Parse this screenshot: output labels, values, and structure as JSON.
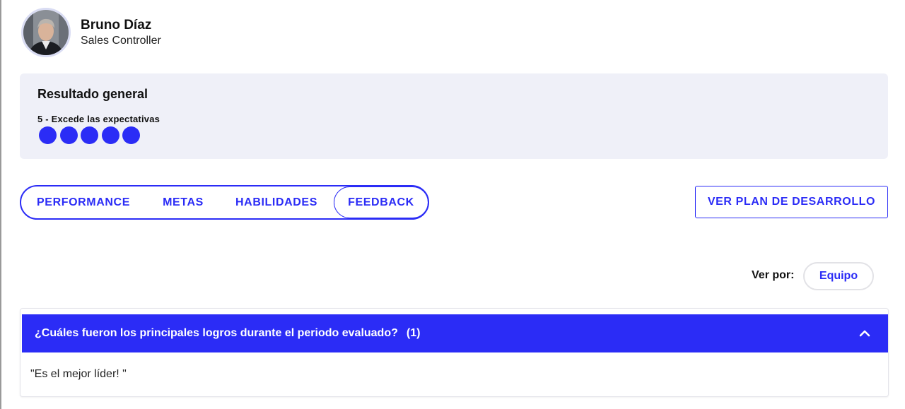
{
  "profile": {
    "name": "Bruno Díaz",
    "role": "Sales Controller"
  },
  "result": {
    "title": "Resultado general",
    "score_label": "5 - Excede las expectativas",
    "score": 5,
    "max_score": 5
  },
  "tabs": [
    {
      "label": "PERFORMANCE",
      "active": false
    },
    {
      "label": "METAS",
      "active": false
    },
    {
      "label": "HABILIDADES",
      "active": false
    },
    {
      "label": "FEEDBACK",
      "active": true
    }
  ],
  "plan_button": {
    "label": "VER PLAN DE DESARROLLO"
  },
  "view_by": {
    "label": "Ver por:",
    "value": "Equipo"
  },
  "feedback": {
    "question": "¿Cuáles fueron los principales logros durante el periodo evaluado?",
    "count": "(1)",
    "answer": "\"Es el mejor líder! \""
  },
  "colors": {
    "accent": "#2b2cf6",
    "card_bg": "#eff0f8"
  },
  "icons": {
    "chevron": "chevron-up-icon"
  }
}
